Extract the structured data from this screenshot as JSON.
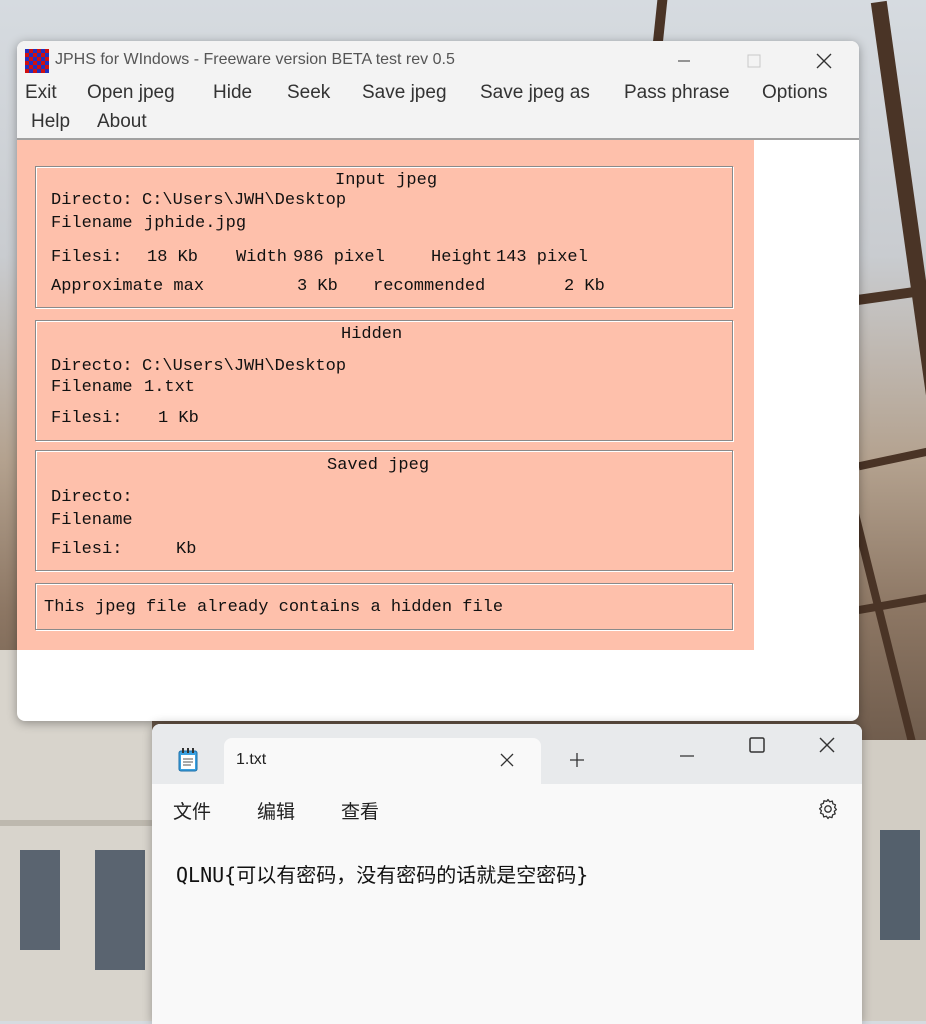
{
  "jphs": {
    "title": "JPHS for WIndows - Freeware version BETA test rev 0.5",
    "menu": [
      "Exit",
      "Open jpeg",
      "Hide",
      "Seek",
      "Save jpeg",
      "Save jpeg as",
      "Pass phrase",
      "Options",
      "Help",
      "About"
    ],
    "input": {
      "heading": "Input jpeg",
      "directory_label": "Directo:",
      "directory_value": "C:\\Users\\JWH\\Desktop",
      "filename_label": "Filename",
      "filename_value": "jphide.jpg",
      "filesize_label": "Filesi:",
      "filesize_value": "18 Kb",
      "width_label": "Width",
      "width_value": "986 pixel",
      "height_label": "Height",
      "height_value": "143 pixel",
      "approx_label": "Approximate max",
      "approx_value": "3 Kb",
      "recommended_label": "recommended",
      "recommended_value": "2 Kb"
    },
    "hidden": {
      "heading": "Hidden",
      "directory_label": "Directo:",
      "directory_value": "C:\\Users\\JWH\\Desktop",
      "filename_label": "Filename",
      "filename_value": "1.txt",
      "filesize_label": "Filesi:",
      "filesize_value": "1 Kb"
    },
    "saved": {
      "heading": "Saved jpeg",
      "directory_label": "Directo:",
      "filename_label": "Filename",
      "filesize_label": "Filesi:",
      "filesize_unit": "Kb"
    },
    "status": "This jpeg file already contains a hidden file"
  },
  "notepad": {
    "tab_title": "1.txt",
    "menu": [
      "文件",
      "编辑",
      "查看"
    ],
    "content": "QLNU{可以有密码，没有密码的话就是空密码}"
  },
  "icons": {
    "jphs_app": "jphs-app-icon",
    "notepad_app": "notepad-icon",
    "settings": "gear-icon"
  }
}
